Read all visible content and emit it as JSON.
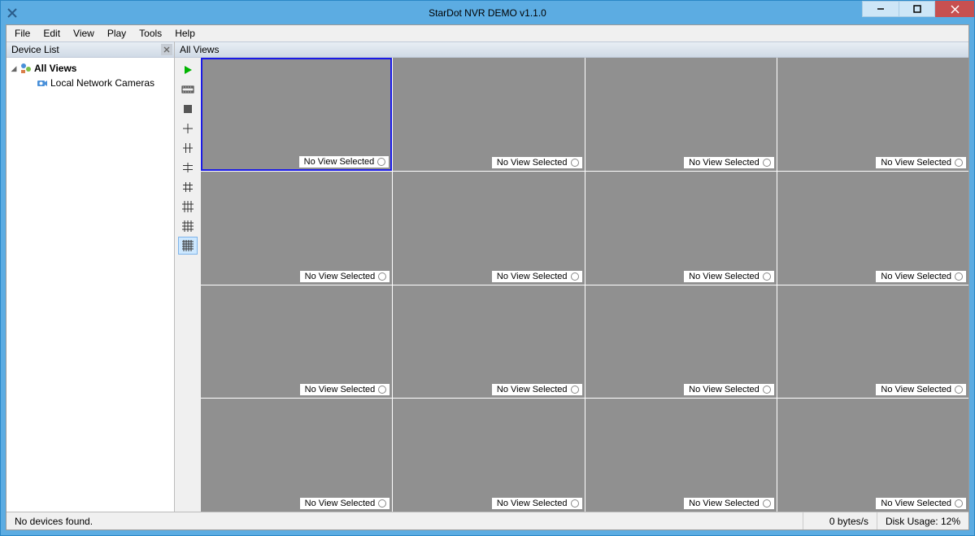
{
  "window": {
    "title": "StarDot NVR DEMO v1.1.0"
  },
  "menus": [
    "File",
    "Edit",
    "View",
    "Play",
    "Tools",
    "Help"
  ],
  "sidebar": {
    "title": "Device List",
    "root": "All Views",
    "child": "Local Network Cameras"
  },
  "views": {
    "header": "All Views",
    "cell_placeholder": "No View Selected",
    "cols": 4,
    "rows": 4,
    "active_index": 0
  },
  "toolbar_buttons": [
    "play",
    "filmstrip",
    "stop",
    "grid-1x1",
    "grid-2x1",
    "grid-2x2",
    "grid-3x2",
    "grid-3x3",
    "grid-4x3",
    "grid-4x4"
  ],
  "toolbar_selected": "grid-4x4",
  "status": {
    "left": "No devices found.",
    "rate": "0 bytes/s",
    "disk": "Disk Usage: 12%"
  }
}
